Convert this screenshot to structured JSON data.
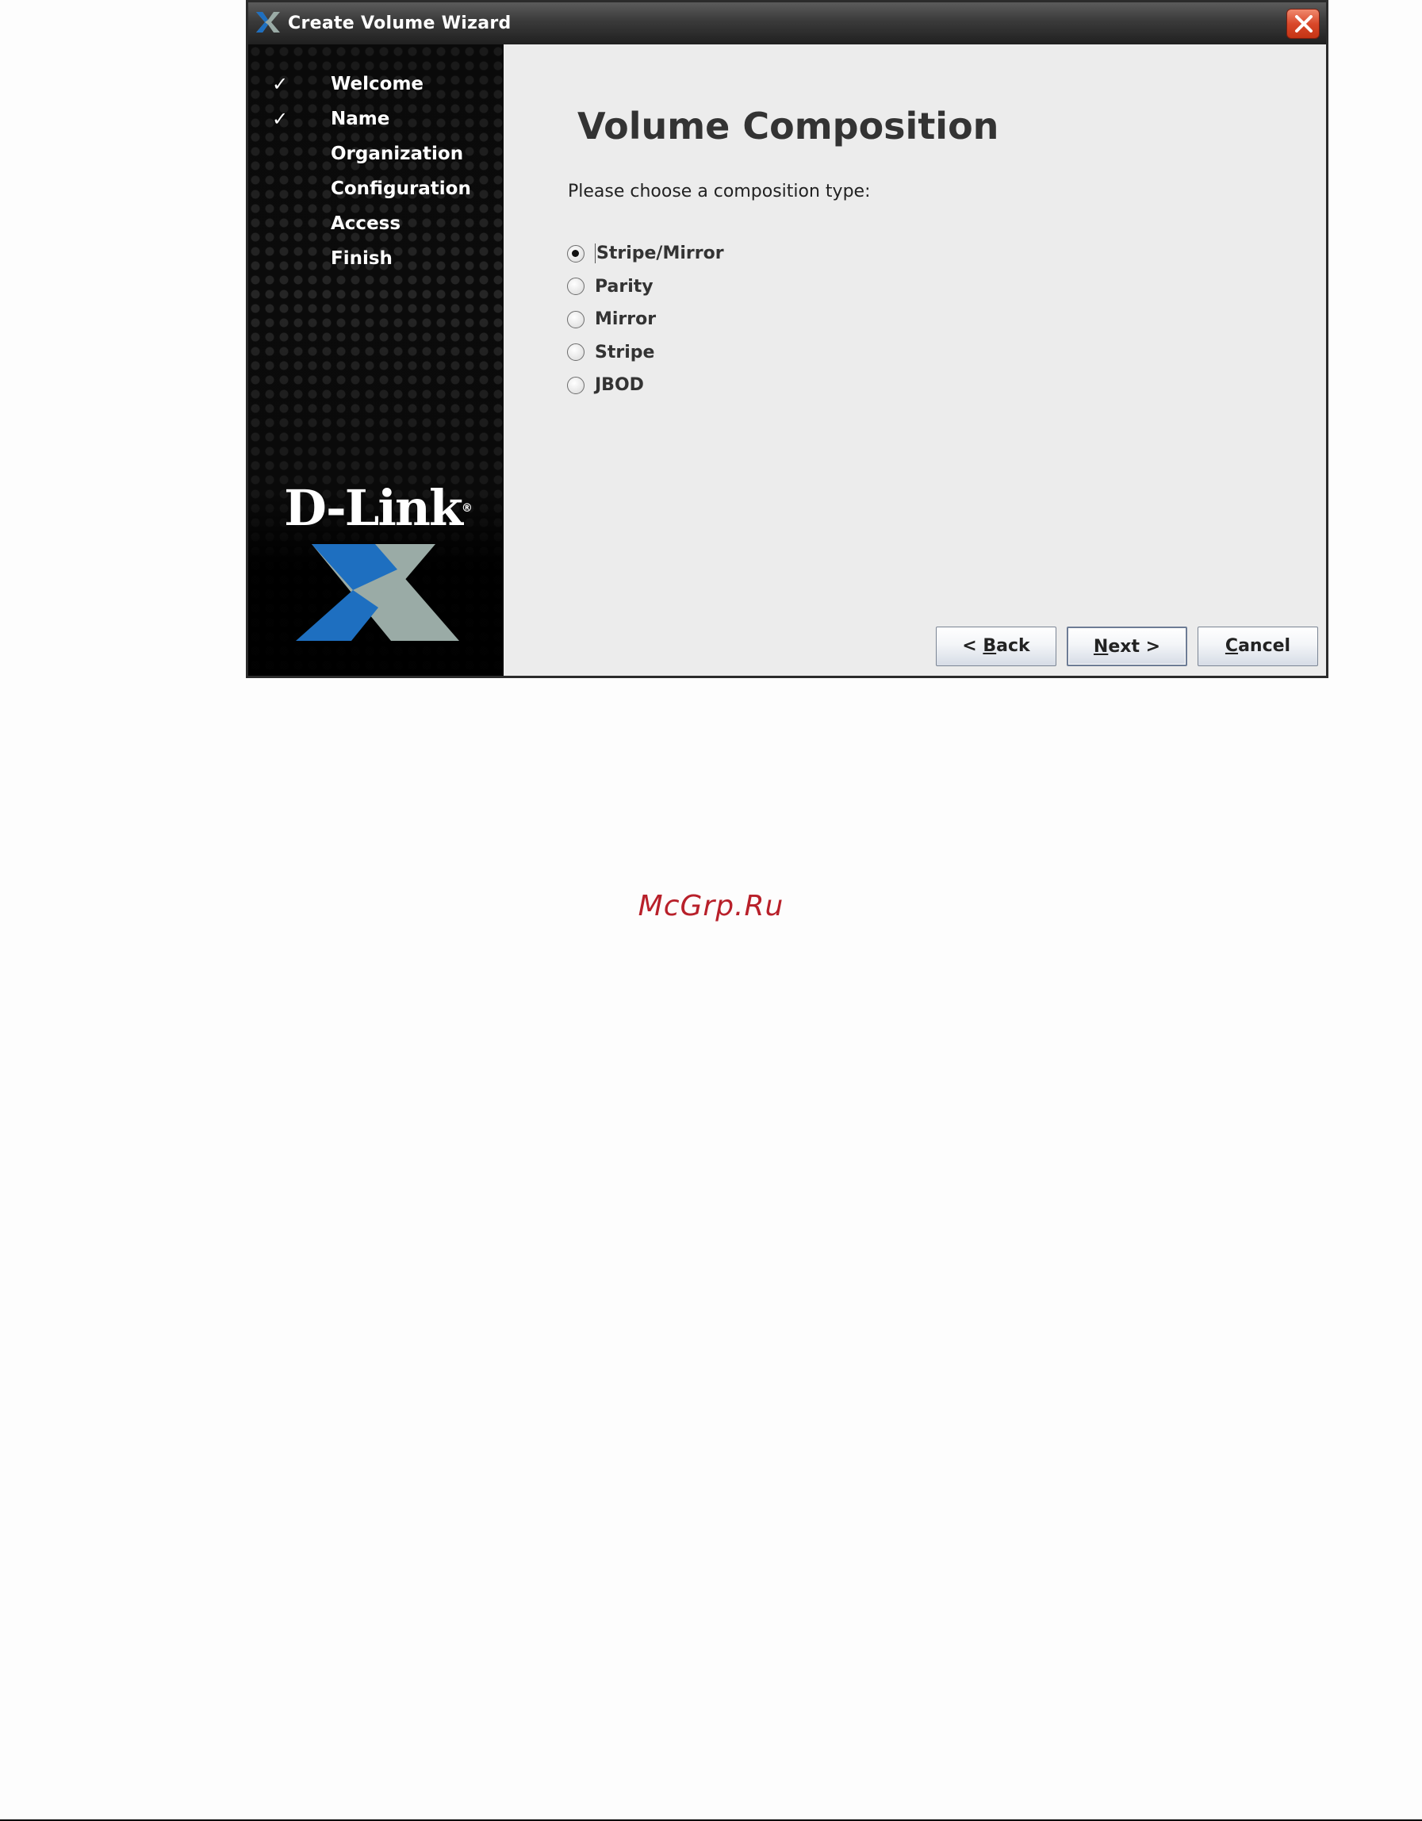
{
  "window": {
    "title": "Create Volume Wizard",
    "close_icon": "close-icon"
  },
  "sidebar": {
    "steps": [
      {
        "label": "Welcome",
        "done": true,
        "check": "✓"
      },
      {
        "label": "Name",
        "done": true,
        "check": "✓"
      },
      {
        "label": "Organization",
        "done": false,
        "check": ""
      },
      {
        "label": "Configuration",
        "done": false,
        "check": ""
      },
      {
        "label": "Access",
        "done": false,
        "check": ""
      },
      {
        "label": "Finish",
        "done": false,
        "check": ""
      }
    ],
    "logo_text": "D-Link",
    "logo_mark": "®"
  },
  "main": {
    "title": "Volume Composition",
    "prompt": "Please choose a composition type:",
    "options": [
      {
        "label": "Stripe/Mirror",
        "checked": true
      },
      {
        "label": "Parity",
        "checked": false
      },
      {
        "label": "Mirror",
        "checked": false
      },
      {
        "label": "Stripe",
        "checked": false
      },
      {
        "label": "JBOD",
        "checked": false
      }
    ]
  },
  "buttons": {
    "back": {
      "prefix": "< ",
      "mnemonic": "B",
      "rest": "ack"
    },
    "next": {
      "prefix": "",
      "mnemonic": "N",
      "rest": "ext >"
    },
    "cancel": {
      "prefix": "",
      "mnemonic": "C",
      "rest": "ancel"
    }
  },
  "watermark": "McGrp.Ru",
  "colors": {
    "titlebar": "#3a3a3a",
    "sidebar": "#0b0b0b",
    "content_bg": "#ececec",
    "close_button": "#d9482a",
    "logo_blue": "#1e6fc0",
    "logo_gray": "#9aaba6",
    "watermark": "#b8202a"
  }
}
